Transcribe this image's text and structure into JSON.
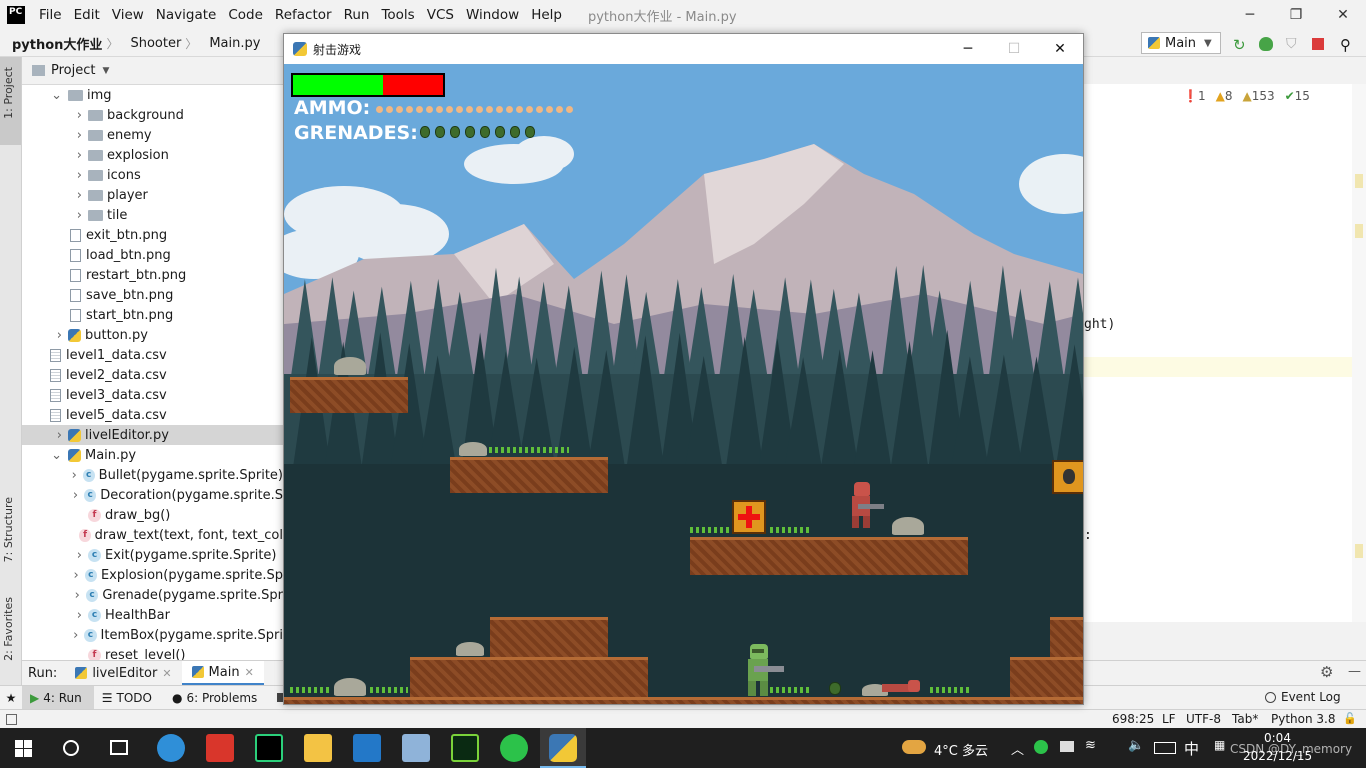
{
  "ide": {
    "menu": [
      "File",
      "Edit",
      "View",
      "Navigate",
      "Code",
      "Refactor",
      "Run",
      "Tools",
      "VCS",
      "Window",
      "Help"
    ],
    "title": "python大作业 - Main.py",
    "logo": "PC",
    "breadcrumbs": [
      "python大作业",
      "Shooter",
      "Main.py"
    ],
    "run_config": "Main",
    "project_label": "Project",
    "left_tabs": [
      "1: Project",
      "7: Structure",
      "2: Favorites"
    ],
    "tree": [
      {
        "label": "img",
        "type": "folder-open",
        "indent": 0
      },
      {
        "label": "background",
        "type": "folder",
        "indent": 1
      },
      {
        "label": "enemy",
        "type": "folder",
        "indent": 1
      },
      {
        "label": "explosion",
        "type": "folder",
        "indent": 1
      },
      {
        "label": "icons",
        "type": "folder",
        "indent": 1
      },
      {
        "label": "player",
        "type": "folder",
        "indent": 1
      },
      {
        "label": "tile",
        "type": "folder",
        "indent": 1
      },
      {
        "label": "exit_btn.png",
        "type": "file",
        "indent": 1
      },
      {
        "label": "load_btn.png",
        "type": "file",
        "indent": 1
      },
      {
        "label": "restart_btn.png",
        "type": "file",
        "indent": 1
      },
      {
        "label": "save_btn.png",
        "type": "file",
        "indent": 1
      },
      {
        "label": "start_btn.png",
        "type": "file",
        "indent": 1
      },
      {
        "label": "button.py",
        "type": "py",
        "indent": 0
      },
      {
        "label": "level1_data.csv",
        "type": "csv",
        "indent": 0
      },
      {
        "label": "level2_data.csv",
        "type": "csv",
        "indent": 0
      },
      {
        "label": "level3_data.csv",
        "type": "csv",
        "indent": 0
      },
      {
        "label": "level5_data.csv",
        "type": "csv",
        "indent": 0
      },
      {
        "label": "livelEditor.py",
        "type": "py",
        "indent": 0,
        "selected": true
      },
      {
        "label": "Main.py",
        "type": "py-open",
        "indent": 0
      },
      {
        "label": "Bullet(pygame.sprite.Sprite)",
        "type": "class",
        "indent": 1
      },
      {
        "label": "Decoration(pygame.sprite.S",
        "type": "class",
        "indent": 1
      },
      {
        "label": "draw_bg()",
        "type": "func",
        "indent": 1
      },
      {
        "label": "draw_text(text, font, text_col",
        "type": "func",
        "indent": 1
      },
      {
        "label": "Exit(pygame.sprite.Sprite)",
        "type": "class",
        "indent": 1
      },
      {
        "label": "Explosion(pygame.sprite.Sp",
        "type": "class",
        "indent": 1
      },
      {
        "label": "Grenade(pygame.sprite.Spr",
        "type": "class",
        "indent": 1
      },
      {
        "label": "HealthBar",
        "type": "class",
        "indent": 1
      },
      {
        "label": "ItemBox(pygame.sprite.Spri",
        "type": "class",
        "indent": 1
      },
      {
        "label": "reset_level()",
        "type": "func",
        "indent": 1
      }
    ],
    "inspections": {
      "errors": "1",
      "warnings": "8",
      "weak": "153",
      "ok": "15"
    },
    "code_fragments": [
      "ght)",
      ":"
    ],
    "run_label": "Run:",
    "run_tabs": [
      "livelEditor",
      "Main"
    ],
    "tool_tabs": [
      "4: Run",
      "TODO",
      "6: Problems"
    ],
    "event_log": "Event Log",
    "status": {
      "position": "698:25",
      "line_sep": "LF",
      "encoding": "UTF-8",
      "indent": "Tab*",
      "interpreter": "Python 3.8"
    }
  },
  "game": {
    "window_title": "射击游戏",
    "health_fraction": 0.6,
    "ammo_label": "AMMO:",
    "ammo_count": 20,
    "grenades_label": "GRENADES:",
    "grenade_count": 8,
    "colors": {
      "health": "#00ff00",
      "damage": "#ff0000",
      "sky": "#6aa9db",
      "ammo": "#f0b783"
    }
  },
  "taskbar": {
    "weather": "4°C 多云",
    "ime": "中",
    "time": "0:04",
    "date": "2022/12/15",
    "watermark": "CSDN @DY_memory"
  }
}
